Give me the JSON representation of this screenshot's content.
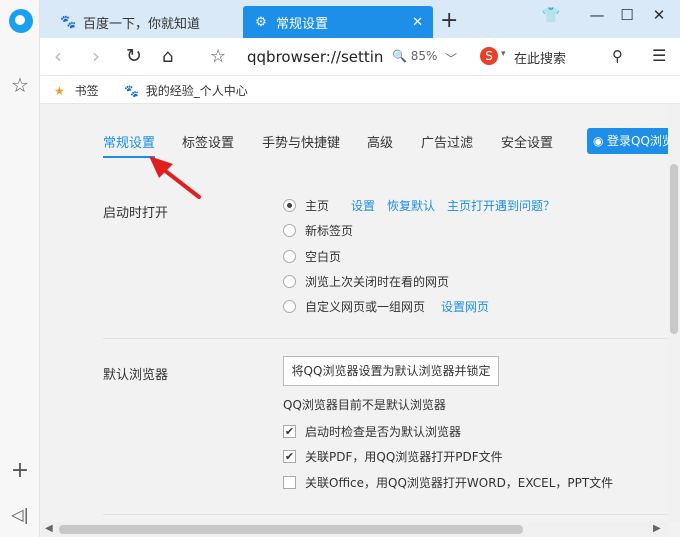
{
  "tabs": [
    {
      "label": "百度一下，你就知道",
      "active": false
    },
    {
      "label": "常规设置",
      "active": true
    }
  ],
  "address": {
    "url": "qqbrowser://settin",
    "zoom": "85%"
  },
  "search": {
    "placeholder": "在此搜索"
  },
  "bookmarks": [
    {
      "label": "书签"
    },
    {
      "label": "我的经验_个人中心"
    }
  ],
  "settings_nav": [
    "常规设置",
    "标签设置",
    "手势与快捷键",
    "高级",
    "广告过滤",
    "安全设置"
  ],
  "login_button": "登录QQ浏览",
  "startup": {
    "label": "启动时打开",
    "options": [
      {
        "label": "主页",
        "checked": true,
        "links": [
          "设置",
          "恢复默认",
          "主页打开遇到问题？"
        ]
      },
      {
        "label": "新标签页",
        "checked": false,
        "links": []
      },
      {
        "label": "空白页",
        "checked": false,
        "links": []
      },
      {
        "label": "浏览上次关闭时在看的网页",
        "checked": false,
        "links": []
      },
      {
        "label": "自定义网页或一组网页",
        "checked": false,
        "links": [
          "设置网页"
        ]
      }
    ]
  },
  "default_browser": {
    "label": "默认浏览器",
    "button": "将QQ浏览器设置为默认浏览器并锁定",
    "status": "QQ浏览器目前不是默认浏览器",
    "checks": [
      {
        "label": "启动时检查是否为默认浏览器",
        "checked": true
      },
      {
        "label": "关联PDF，用QQ浏览器打开PDF文件",
        "checked": true
      },
      {
        "label": "关联Office，用QQ浏览器打开WORD，EXCEL，PPT文件",
        "checked": false
      }
    ]
  },
  "colors": {
    "accent": "#1e8fe8",
    "tabbar": "#d9e9f7",
    "arrow": "#e02020"
  }
}
